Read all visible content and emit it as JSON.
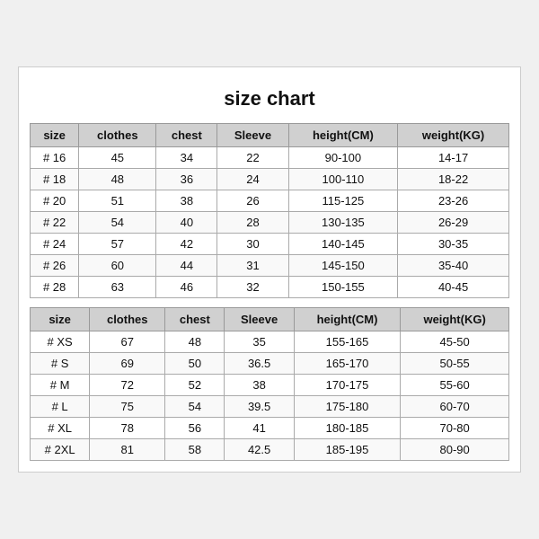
{
  "title": "size chart",
  "table1": {
    "headers": [
      "size",
      "clothes",
      "chest",
      "Sleeve",
      "height(CM)",
      "weight(KG)"
    ],
    "rows": [
      [
        "# 16",
        "45",
        "34",
        "22",
        "90-100",
        "14-17"
      ],
      [
        "# 18",
        "48",
        "36",
        "24",
        "100-110",
        "18-22"
      ],
      [
        "# 20",
        "51",
        "38",
        "26",
        "115-125",
        "23-26"
      ],
      [
        "# 22",
        "54",
        "40",
        "28",
        "130-135",
        "26-29"
      ],
      [
        "# 24",
        "57",
        "42",
        "30",
        "140-145",
        "30-35"
      ],
      [
        "# 26",
        "60",
        "44",
        "31",
        "145-150",
        "35-40"
      ],
      [
        "# 28",
        "63",
        "46",
        "32",
        "150-155",
        "40-45"
      ]
    ]
  },
  "table2": {
    "headers": [
      "size",
      "clothes",
      "chest",
      "Sleeve",
      "height(CM)",
      "weight(KG)"
    ],
    "rows": [
      [
        "# XS",
        "67",
        "48",
        "35",
        "155-165",
        "45-50"
      ],
      [
        "# S",
        "69",
        "50",
        "36.5",
        "165-170",
        "50-55"
      ],
      [
        "# M",
        "72",
        "52",
        "38",
        "170-175",
        "55-60"
      ],
      [
        "# L",
        "75",
        "54",
        "39.5",
        "175-180",
        "60-70"
      ],
      [
        "# XL",
        "78",
        "56",
        "41",
        "180-185",
        "70-80"
      ],
      [
        "# 2XL",
        "81",
        "58",
        "42.5",
        "185-195",
        "80-90"
      ]
    ]
  }
}
